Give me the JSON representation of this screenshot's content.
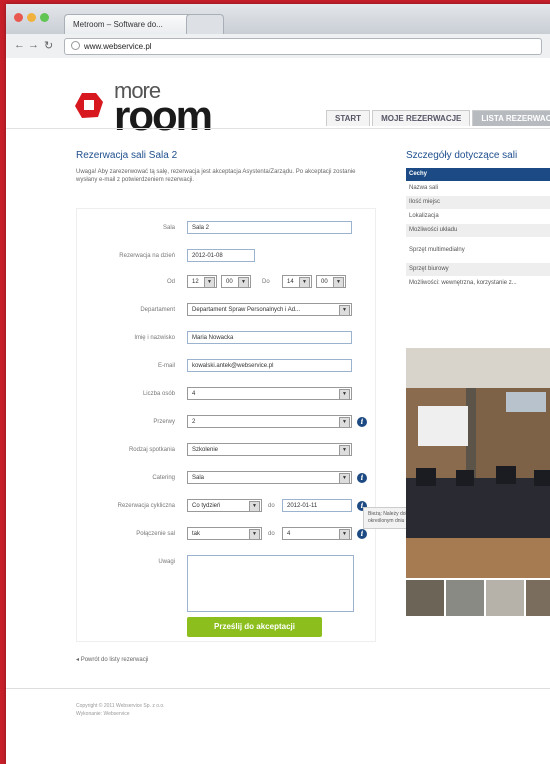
{
  "browser": {
    "tabs": [
      "Metroom – Software do...",
      ""
    ],
    "url": "www.webservice.pl"
  },
  "logo": {
    "line1": "more",
    "line2": "room"
  },
  "nav": {
    "items": [
      "START",
      "MOJE REZERWACJE",
      "LISTA REZERWACJI"
    ],
    "active": 2
  },
  "form": {
    "title": "Rezerwacja sali Sala 2",
    "intro": "Uwaga! Aby zarezerwować tą salę, rezerwacja jest akceptacja Asystenta/Zarządu. Po akceptacji zostanie wysłany e-mail z potwierdzeniem rezerwacji.",
    "fields": {
      "sala": {
        "label": "Sala",
        "value": "Sala 2"
      },
      "date": {
        "label": "Rezerwacja na dzień",
        "value": "2012-01-08"
      },
      "time": {
        "label_from": "Od",
        "from_h": "12",
        "from_m": "00",
        "label_to": "Do",
        "to_h": "14",
        "to_m": "00"
      },
      "dept": {
        "label": "Departament",
        "value": "Departament Spraw Personalnych i Ad..."
      },
      "owner": {
        "label": "Imię i nazwisko",
        "value": "Maria Nowacka"
      },
      "email": {
        "label": "E-mail",
        "value": "kowalski.antek@webservice.pl"
      },
      "people": {
        "label": "Liczba osób",
        "value": "4"
      },
      "breaks": {
        "label": "Przerwy",
        "value": "2"
      },
      "layout": {
        "label": "Rodzaj spotkania",
        "value": "Szkolenie"
      },
      "catering": {
        "label": "Catering",
        "value": "Sala"
      },
      "cyclic": {
        "label": "Rezerwacja cykliczna",
        "value": "Co tydzień",
        "to_label": "do",
        "to_value": "2012-01-11"
      },
      "combined": {
        "label": "Połączenie sal",
        "value": "tak",
        "to_label": "do",
        "to_value": "4"
      },
      "notes": {
        "label": "Uwagi",
        "value": ""
      }
    },
    "submit": "Prześlij do akceptacji",
    "tooltip": "Bieżą: Należy dokonać rezerwacji cyklicznej dla sali, rezerwacja tylko w określonym dniu tygodnia"
  },
  "back_link": "Powrót do listy rezerwacji",
  "footer": {
    "line1": "Copyright © 2011 Webservice Sp. z o.o.",
    "line2": "Wykonanie: Webservice"
  },
  "details": {
    "title": "Szczegóły dotyczące sali",
    "rows": [
      {
        "text": "Cechy",
        "style": "header"
      },
      {
        "text": "Nazwa sali",
        "style": "normal"
      },
      {
        "text": "Ilość miejsc",
        "style": "grey"
      },
      {
        "text": "Lokalizacja",
        "style": "normal"
      },
      {
        "text": "Możliwości układu",
        "style": "grey"
      },
      {
        "text": "Sprzęt multimedialny",
        "style": "tall"
      },
      {
        "text": "Sprzęt biurowy",
        "style": "grey"
      },
      {
        "text": "Możliwości: wewnętrzna, korzystanie z...",
        "style": "normal"
      }
    ]
  },
  "colors": {
    "accent": "#1b4a84",
    "submit": "#8cbf1e",
    "brand": "#d8181f"
  }
}
